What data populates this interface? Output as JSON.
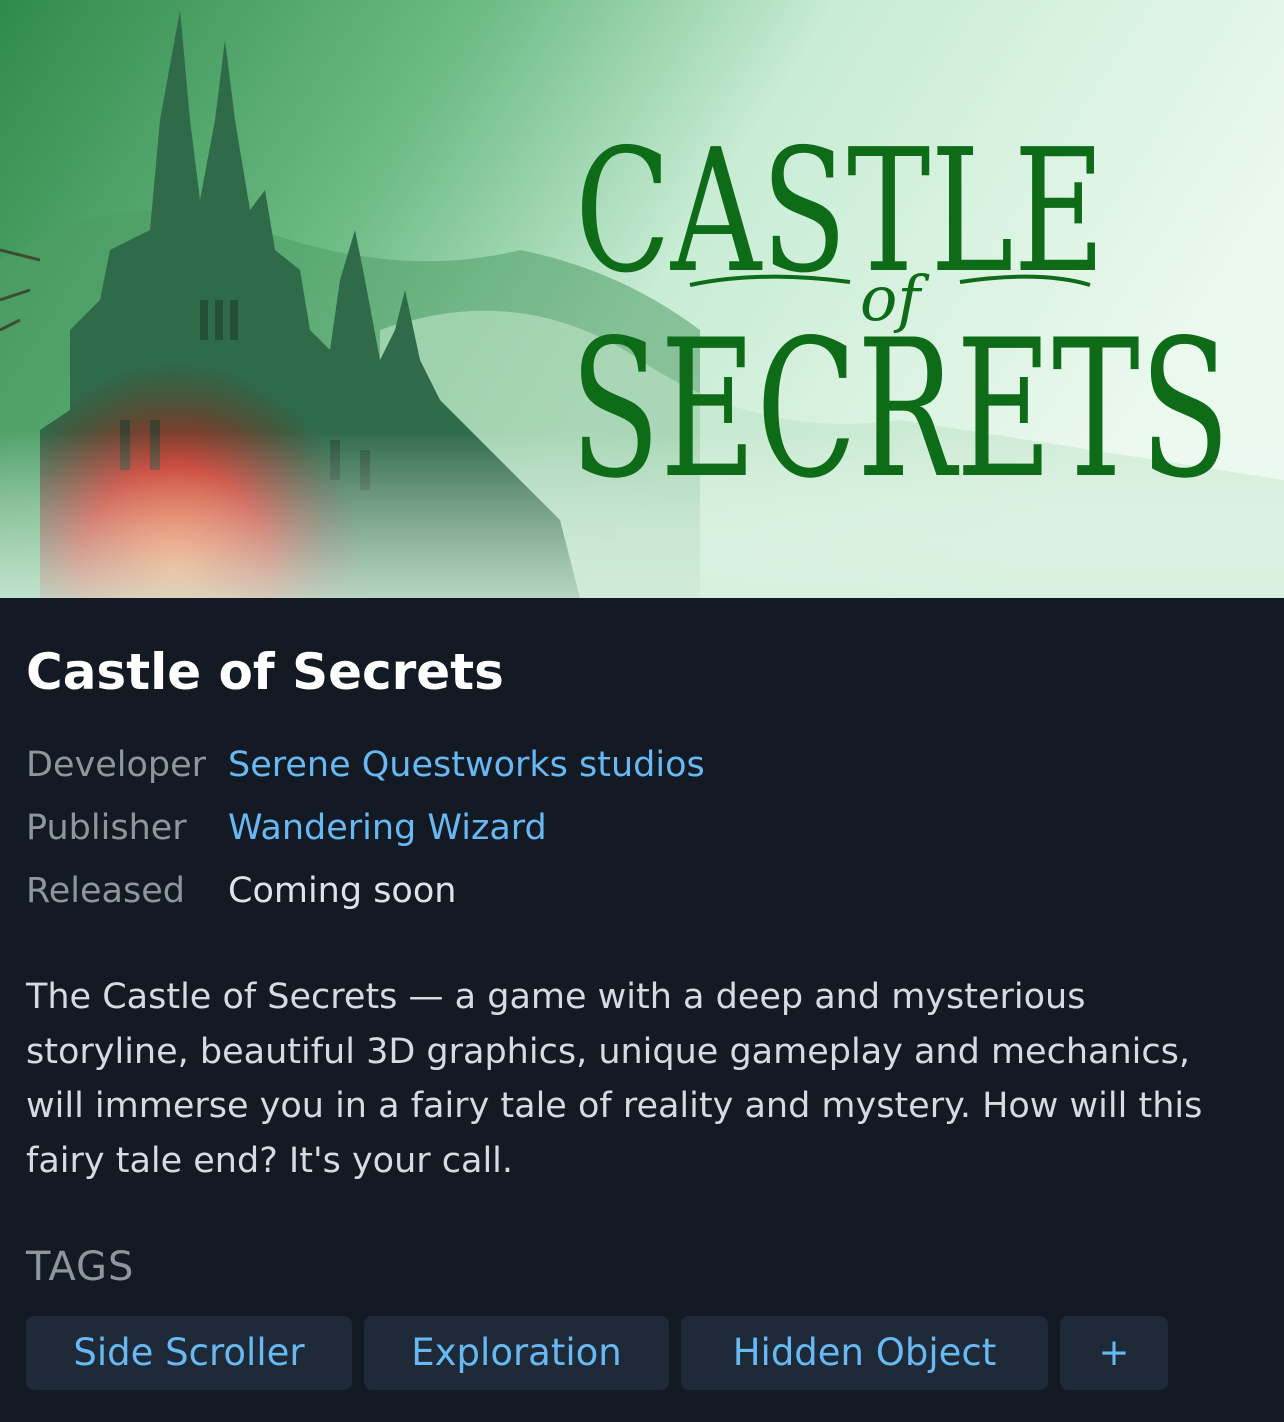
{
  "banner": {
    "logo_top": "CASTLE",
    "logo_mid": "of",
    "logo_bottom": "SECRETS",
    "logo_color": "#0e6b17"
  },
  "game": {
    "title": "Castle of Secrets",
    "developer_label": "Developer",
    "developer": "Serene Questworks studios",
    "publisher_label": "Publisher",
    "publisher": "Wandering Wizard",
    "released_label": "Released",
    "released": "Coming soon",
    "description": "The Castle of Secrets — a game with a deep and mysterious storyline, beautiful 3D graphics, unique gameplay and mechanics, will immerse you in a fairy tale of reality and mystery. How will this fairy tale end? It's your call."
  },
  "tags": {
    "heading": "TAGS",
    "items": [
      "Side Scroller",
      "Exploration",
      "Hidden Object"
    ],
    "more_label": "+"
  },
  "colors": {
    "background": "#131a23",
    "link": "#67b8f3",
    "label": "#8e959d",
    "tag_bg": "#1f2a38"
  }
}
